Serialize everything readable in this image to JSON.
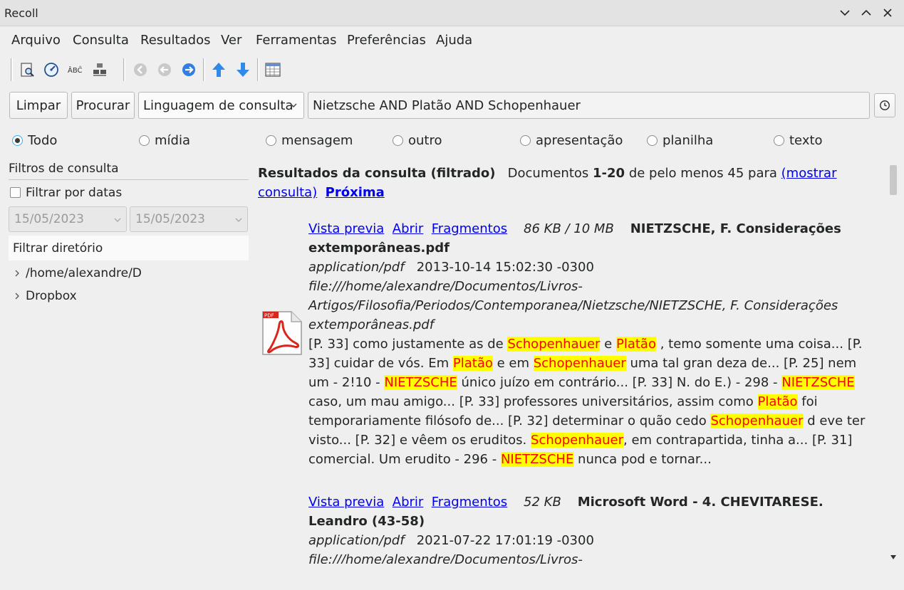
{
  "window": {
    "title": "Recoll"
  },
  "menu": [
    "Arquivo",
    "Consulta",
    "Resultados",
    "Ver",
    "Ferramentas",
    "Preferências",
    "Ajuda"
  ],
  "search": {
    "clear_label": "Limpar",
    "search_label": "Procurar",
    "mode": "Linguagem de consulta",
    "query": "Nietzsche AND Platão AND Schopenhauer"
  },
  "filters": {
    "categories": [
      "Todo",
      "mídia",
      "mensagem",
      "outro",
      "apresentação",
      "planilha",
      "texto"
    ],
    "selected": "Todo"
  },
  "sidebar": {
    "title": "Filtros de consulta",
    "date_filter_label": "Filtrar por datas",
    "date_from": "15/05/2023",
    "date_to": "15/05/2023",
    "dir_filter_label": "Filtrar diretório",
    "tree": [
      "/home/alexandre/D",
      "Dropbox"
    ]
  },
  "results": {
    "heading": "Resultados da consulta (filtrado)",
    "summary_pre": "Documentos",
    "range": "1-20",
    "summary_post": "de pelo menos 45 para",
    "show_query_link": "(mostrar consulta)",
    "next_link": "Próxima",
    "items": [
      {
        "link_preview": "Vista previa",
        "link_open": "Abrir",
        "link_snippets": "Fragmentos",
        "size": "86 KB / 10 MB",
        "title": "NIETZSCHE, F. Considerações extemporâneas.pdf",
        "mime": "application/pdf",
        "date": "2013-10-14 15:02:30 -0300",
        "url": "file:///home/alexandre/Documentos/Livros-Artigos/Filosofia/Periodos/Contemporanea/Nietzsche/NIETZSCHE, F. Considerações extemporâneas.pdf",
        "snippet": [
          {
            "t": "[P. 33] como justamente as de "
          },
          {
            "t": "Schopenhauer",
            "h": true
          },
          {
            "t": " e "
          },
          {
            "t": "Platão",
            "h": true
          },
          {
            "t": " , temo somente uma coisa... [P. 33] cuidar de vós. Em "
          },
          {
            "t": "Platão",
            "h": true
          },
          {
            "t": " e em "
          },
          {
            "t": "Schopenhauer",
            "h": true
          },
          {
            "t": " uma tal gran deza de... [P. 25] nem um - 2!10 - "
          },
          {
            "t": "NIETZSCHE",
            "h": true
          },
          {
            "t": " único juízo em contrário... [P. 33] N. do E.) - 298 - "
          },
          {
            "t": "NIETZSCHE",
            "h": true
          },
          {
            "t": " caso, um mau amigo... [P. 33] professores universitários, assim como "
          },
          {
            "t": "Platão",
            "h": true
          },
          {
            "t": " foi temporariamente filósofo de... [P. 32] determinar o quão cedo "
          },
          {
            "t": "Schopenhauer",
            "h": true
          },
          {
            "t": " d eve ter visto... [P. 32] e vêem os eruditos. "
          },
          {
            "t": "Schopenhauer",
            "h": true
          },
          {
            "t": ", em contrapartida, tinha a... [P. 31] comercial. Um erudito - 296 - "
          },
          {
            "t": "NIETZSCHE",
            "h": true
          },
          {
            "t": " nunca pod e tornar..."
          }
        ]
      },
      {
        "link_preview": "Vista previa",
        "link_open": "Abrir",
        "link_snippets": "Fragmentos",
        "size": "52 KB",
        "title": "Microsoft Word - 4. CHEVITARESE. Leandro (43-58)",
        "mime": "application/pdf",
        "date": "2021-07-22 17:01:19 -0300",
        "url": "file:///home/alexandre/Documentos/Livros-Artigos/Filosofia/Periodos/Contemporanea/Schopenhauer/Atualidade-de-"
      }
    ]
  }
}
